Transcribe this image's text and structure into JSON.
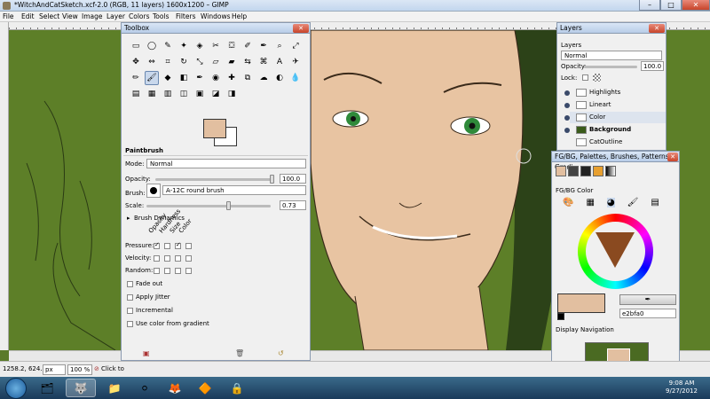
{
  "window": {
    "title": "*WitchAndCatSketch.xcf-2.0 (RGB, 11 layers) 1600x1200 – GIMP",
    "min": "–",
    "max": "□",
    "close": "✕"
  },
  "menubar": {
    "items": [
      "File",
      "Edit",
      "Select",
      "View",
      "Image",
      "Layer",
      "Colors",
      "Tools",
      "Filters",
      "Windows",
      "Help"
    ]
  },
  "toolbox": {
    "title": "Toolbox",
    "close": "✕",
    "tools": [
      "rect-select",
      "ellipse-select",
      "free-select",
      "fuzzy-select",
      "by-color-select",
      "scissors",
      "foreground-select",
      "paths",
      "color-picker",
      "zoom",
      "measure",
      "move",
      "align",
      "crop",
      "rotate",
      "scale",
      "shear",
      "perspective",
      "flip",
      "cage",
      "text",
      "airbrush",
      "pencil",
      "paintbrush",
      "bucket-fill",
      "eraser",
      "ink",
      "clone",
      "heal",
      "perspective-clone",
      "smudge",
      "dodge-burn",
      "blur",
      "blend",
      "dodge",
      "gradient",
      "desaturate",
      "levels",
      "colorize",
      "hue"
    ],
    "tool_glyphs": [
      "▭",
      "◯",
      "✎",
      "✦",
      "◈",
      "✂",
      "⛋",
      "✐",
      "✒",
      "⌕",
      "⤢",
      "✥",
      "⇔",
      "⌗",
      "↻",
      "⤡",
      "▱",
      "▰",
      "⇆",
      "⌘",
      "A",
      "✈",
      "✏",
      "🖌",
      "◆",
      "◧",
      "✒",
      "◉",
      "✚",
      "⧉",
      "☁",
      "◐",
      "💧",
      "▤",
      "▦",
      "▥",
      "◫",
      "▣",
      "◪",
      "◨"
    ],
    "fg_color": "#e2bfa0",
    "bg_color": "#ffffff",
    "options_title": "Paintbrush",
    "mode_label": "Mode:",
    "mode_value": "Normal",
    "opacity_label": "Opacity:",
    "opacity_value": "100.0",
    "brush_label": "Brush:",
    "brush_value": "A-12C round brush",
    "scale_label": "Scale:",
    "scale_value": "0.73",
    "dynamics_label": "Brush Dynamics",
    "dyn_cols": [
      "Opacity",
      "Hardness",
      "Size",
      "Color"
    ],
    "pressure_label": "Pressure:",
    "velocity_label": "Velocity:",
    "random_label": "Random:",
    "fade_out": "Fade out",
    "apply_jitter": "Apply Jitter",
    "incremental": "Incremental",
    "use_color_gradient": "Use color from gradient"
  },
  "layers": {
    "title": "Layers",
    "close": "✕",
    "section": "Layers",
    "mode_value": "Normal",
    "opacity_label": "Opacity:",
    "opacity_value": "100.0",
    "lock_label": "Lock:",
    "items": [
      "Highlights",
      "Lineart",
      "Color",
      "Background",
      "CatOutline"
    ]
  },
  "fgbg": {
    "title": "FG/BG, Palettes, Brushes, Patterns, Gradi...",
    "close": "✕",
    "section": "FG/BG Color",
    "hex_value": "e2bfa0",
    "nav_title": "Display Navigation"
  },
  "status": {
    "coord": "1258.2, 624.6",
    "unit": "px",
    "zoom": "100 %",
    "message": "Click to"
  },
  "taskbar": {
    "time": "9:08 AM",
    "date": "9/27/2012"
  }
}
